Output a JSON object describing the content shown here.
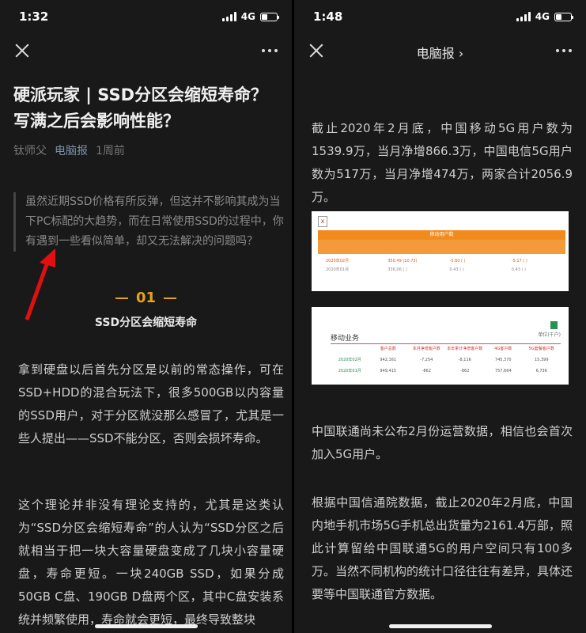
{
  "left": {
    "status": {
      "time": "1:32",
      "network": "4G"
    },
    "title": "硬派玩家 | SSD分区会缩短寿命？写满之后会影响性能？",
    "author": "钛师父",
    "account": "电脑报",
    "time_ago": "1周前",
    "quote": "虽然近期SSD价格有所反弹，但这并不影响其成为当下PC标配的大趋势，而在日常使用SSD的过程中，你有遇到一些看似简单，却又无法解决的问题吗？",
    "section_number": "01",
    "section_title": "SSD分区会缩短寿命",
    "para1": "拿到硬盘以后首先分区是以前的常态操作，可在SSD+HDD的混合玩法下，很多500GB以内容量的SSD用户，对于分区就没那么感冒了，尤其是一些人提出——SSD不能分区，否则会损坏寿命。",
    "para2_a": "这个理论并非没有理论支持的，尤其是这类认为“SSD分区会缩短寿命”的人认为“SSD分区之后就相当于把一块大容量硬盘变成了几块小容量硬盘，寿命更短。一块240GB SSD，如果分成50GB C盘、190GB D盘两个区，其中C盘安装系统并频繁使用，",
    "para2_u": "寿命就会更短",
    "para2_b": "，最终导致整块"
  },
  "right": {
    "status": {
      "time": "1:48",
      "network": "4G"
    },
    "nav_title": "电脑报 ›",
    "para1": "截止2020年2月底，中国移动5G用户数为1539.9万，当月净增866.3万，中国电信5G用户数为517万，当月净增474万，两家合计2056.9万。",
    "table1": {
      "header": "移动用户数",
      "row1": [
        "2020年02月",
        "350.49 (10.73)",
        "-5.60 ( )",
        "-5.17 ( )"
      ],
      "row2": [
        "2020年01月",
        "336.06 ( )",
        "0.43 ( )",
        "0.43 ( )"
      ]
    },
    "table2": {
      "title": "移动业务",
      "unit": "单位(千户)",
      "headers": [
        "",
        "客户总数",
        "本月净增客户数",
        "本年累计净增客户数",
        "4G客户数",
        "5G套餐客户数"
      ],
      "row1": [
        "2020年02月",
        "942,161",
        "-7,254",
        "-8,116",
        "745,370",
        "15,399"
      ],
      "row2": [
        "2020年01月",
        "949,415",
        "-862",
        "-862",
        "757,664",
        "6,736"
      ]
    },
    "para2": "中国联通尚未公布2月份运营数据，相信也会首次加入5G用户。",
    "para3": "根据中国信通院数据，截止2020年2月底，中国内地手机市场5G手机总出货量为2161.4万部，照此计算留给中国联通5G的用户空间只有100多万。当然不同机构的统计口径往往有差异，具体还要等中国联通官方数据。"
  }
}
